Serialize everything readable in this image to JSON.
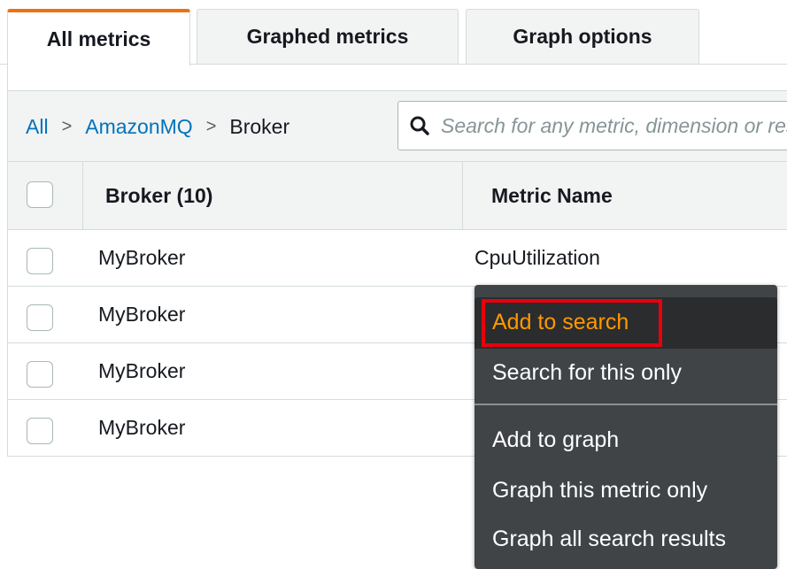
{
  "tabs": [
    "All metrics",
    "Graphed metrics",
    "Graph options"
  ],
  "breadcrumb": {
    "root": "All",
    "namespace": "AmazonMQ",
    "current": "Broker",
    "separator": ">"
  },
  "search": {
    "placeholder": "Search for any metric, dimension or resource id",
    "value": ""
  },
  "table": {
    "headers": {
      "broker": "Broker (10)",
      "metric": "Metric Name"
    },
    "rows": [
      {
        "broker": "MyBroker",
        "metric": "CpuUtilization"
      },
      {
        "broker": "MyBroker",
        "metric": ""
      },
      {
        "broker": "MyBroker",
        "metric": ""
      },
      {
        "broker": "MyBroker",
        "metric": ""
      }
    ]
  },
  "context_menu": {
    "items": [
      "Add to search",
      "Search for this only",
      "Add to graph",
      "Graph this metric only",
      "Graph all search results"
    ]
  },
  "colors": {
    "accent": "#ec7211",
    "link": "#0073bb",
    "highlight_text": "#ff9900",
    "highlight_box": "#e8000d",
    "menu_bg": "#414447"
  },
  "icons": {
    "search": "search-icon"
  }
}
